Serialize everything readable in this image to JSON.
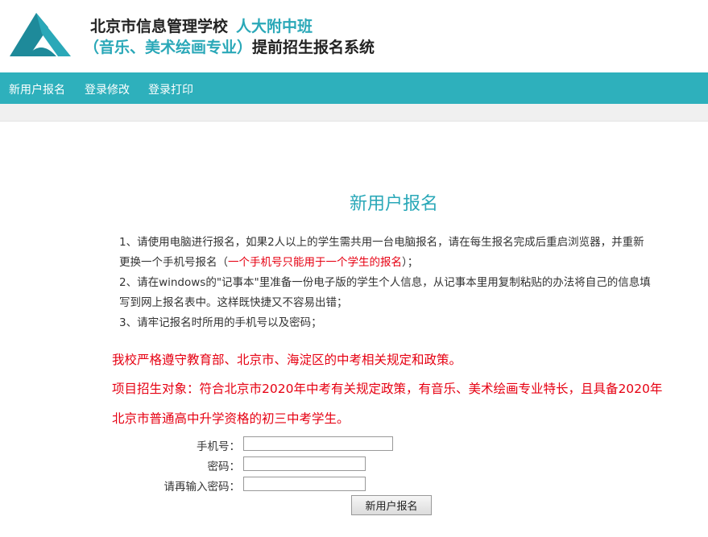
{
  "header": {
    "school_name": "北京市信息管理学校",
    "class_name": "人大附中班",
    "majors": "（音乐、美术绘画专业）",
    "system_name": "提前招生报名系统",
    "logo_icon": "school-logo-icon",
    "accent_color": "#2aa8b8"
  },
  "nav": {
    "bar_color": "#2eb0bc",
    "items": [
      {
        "label": "新用户报名"
      },
      {
        "label": "登录修改"
      },
      {
        "label": "登录打印"
      }
    ]
  },
  "main": {
    "title": "新用户报名",
    "instructions": {
      "line1": "1、请使用电脑进行报名，如果2人以上的学生需共用一台电脑报名，请在每生报名完成后重启浏览器，并重新",
      "line2_prefix": "更换一个手机号报名（",
      "line2_red": "一个手机号只能用于一个学生的报名",
      "line2_suffix": "）；",
      "line3": "2、请在windows的\"记事本\"里准备一份电子版的学生个人信息，从记事本里用复制粘贴的办法将自己的信息填",
      "line4": "写到网上报名表中。这样既快捷又不容易出错；",
      "line5": "3、请牢记报名时所用的手机号以及密码；"
    },
    "policy": {
      "line1": "我校严格遵守教育部、北京市、海淀区的中考相关规定和政策。",
      "line2": "项目招生对象：符合北京市2020年中考有关规定政策，有音乐、美术绘画专业特长，且具备2020年",
      "line3": "北京市普通高中升学资格的初三中考学生。",
      "color": "#e60012"
    },
    "form": {
      "phone_label": "手机号：",
      "phone_value": "",
      "password_label": "密码：",
      "password_value": "",
      "confirm_label": "请再输入密码：",
      "confirm_value": "",
      "submit_label": "新用户报名"
    }
  }
}
